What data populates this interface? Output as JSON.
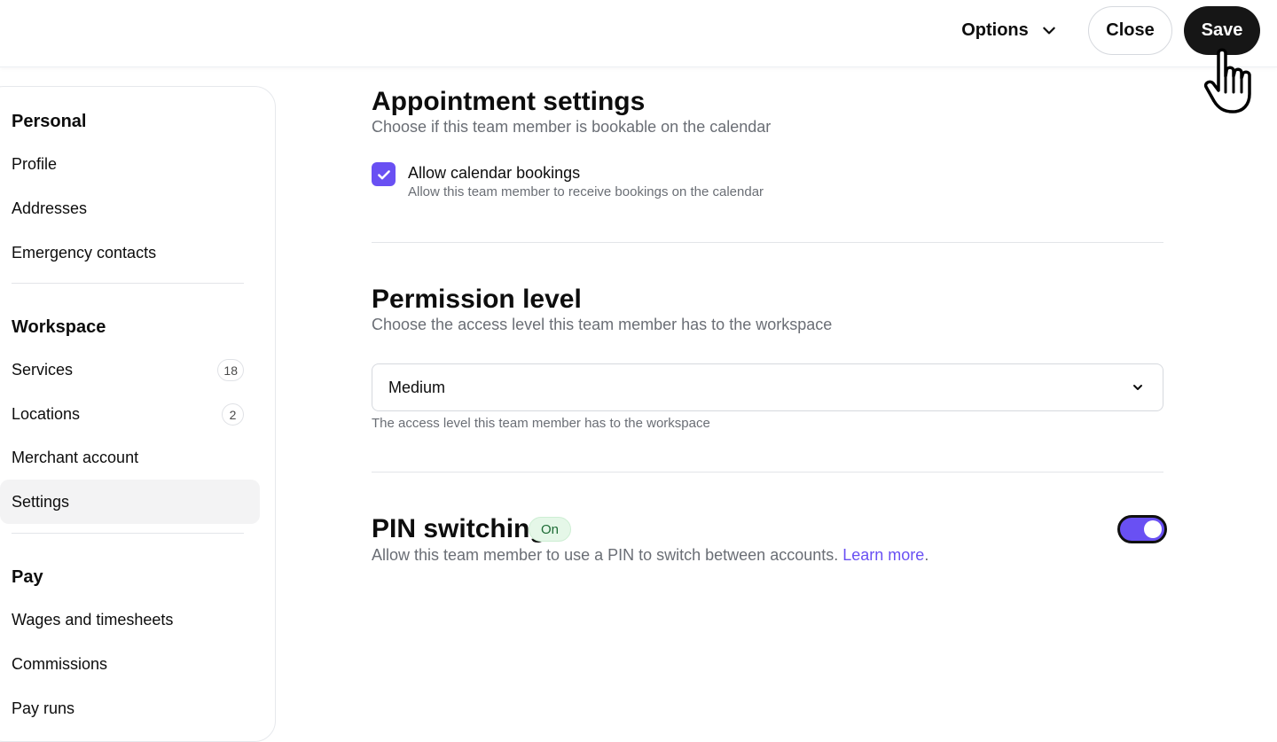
{
  "header": {
    "options_label": "Options",
    "close_label": "Close",
    "save_label": "Save"
  },
  "sidebar": {
    "sections": [
      {
        "title": "Personal",
        "items": [
          {
            "label": "Profile"
          },
          {
            "label": "Addresses"
          },
          {
            "label": "Emergency contacts"
          }
        ]
      },
      {
        "title": "Workspace",
        "items": [
          {
            "label": "Services",
            "count": "18"
          },
          {
            "label": "Locations",
            "count": "2"
          },
          {
            "label": "Merchant account"
          },
          {
            "label": "Settings",
            "active": true
          }
        ]
      },
      {
        "title": "Pay",
        "items": [
          {
            "label": "Wages and timesheets"
          },
          {
            "label": "Commissions"
          },
          {
            "label": "Pay runs"
          }
        ]
      }
    ]
  },
  "appointment": {
    "title": "Appointment settings",
    "subtitle": "Choose if this team member is bookable on the calendar",
    "checkbox_label": "Allow calendar bookings",
    "checkbox_help": "Allow this team member to receive bookings on the calendar",
    "checked": true
  },
  "permission": {
    "title": "Permission level",
    "subtitle": "Choose the access level this team member has to the workspace",
    "selected": "Medium",
    "help": "The access level this team member has to the workspace"
  },
  "pin": {
    "title": "PIN switching",
    "badge": "On",
    "description": "Allow this team member to use a PIN to switch between accounts.",
    "link": "Learn more",
    "link_suffix": ".",
    "enabled": true
  },
  "colors": {
    "accent": "#6950f3",
    "primary_button": "#161616",
    "badge_bg": "#e5f7e8"
  }
}
